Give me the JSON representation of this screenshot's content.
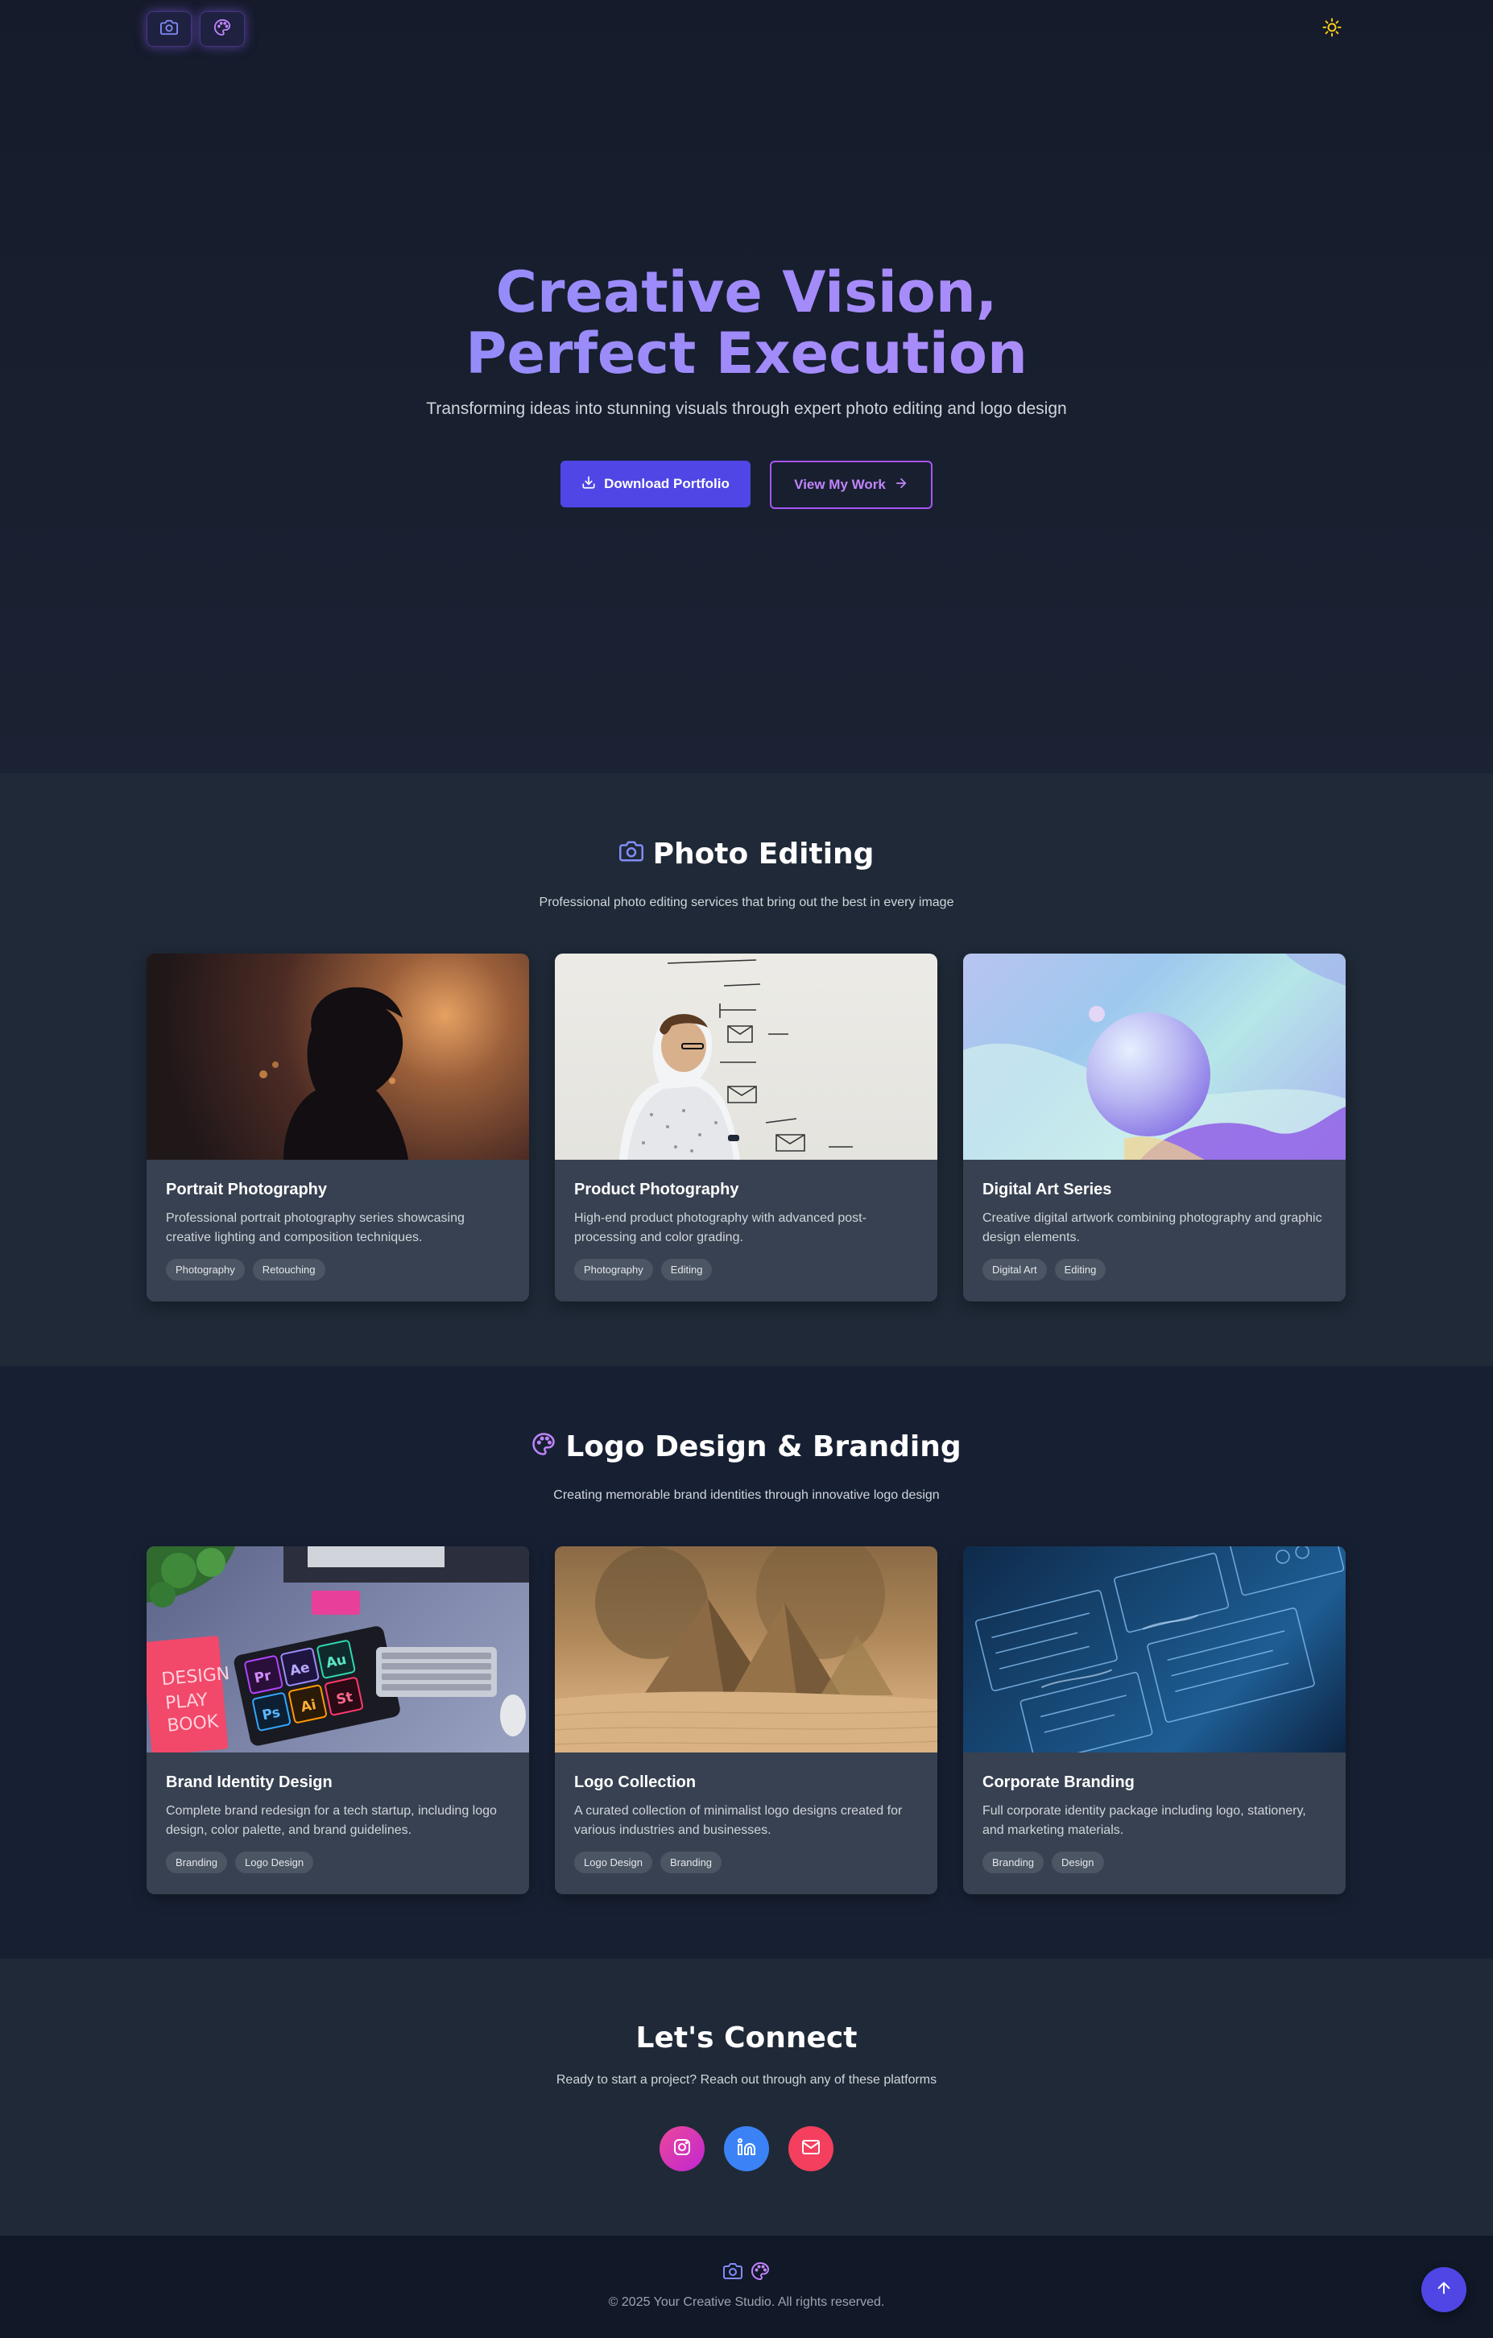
{
  "header": {
    "logo_icons": [
      "camera-icon",
      "palette-icon"
    ],
    "theme_toggle_icon": "sun-icon"
  },
  "hero": {
    "title_line1": "Creative Vision,",
    "title_line2": "Perfect Execution",
    "subtitle": "Transforming ideas into stunning visuals through expert photo editing and logo design",
    "primary_button": "Download Portfolio",
    "secondary_button": "View My Work"
  },
  "photo_section": {
    "title": "Photo Editing",
    "subtitle": "Professional photo editing services that bring out the best in every image",
    "cards": [
      {
        "title": "Portrait Photography",
        "description": "Professional portrait photography series showcasing creative lighting and composition techniques.",
        "tags": [
          "Photography",
          "Retouching"
        ]
      },
      {
        "title": "Product Photography",
        "description": "High-end product photography with advanced post-processing and color grading.",
        "tags": [
          "Photography",
          "Editing"
        ]
      },
      {
        "title": "Digital Art Series",
        "description": "Creative digital artwork combining photography and graphic design elements.",
        "tags": [
          "Digital Art",
          "Editing"
        ]
      }
    ]
  },
  "logo_section": {
    "title": "Logo Design & Branding",
    "subtitle": "Creating memorable brand identities through innovative logo design",
    "cards": [
      {
        "title": "Brand Identity Design",
        "description": "Complete brand redesign for a tech startup, including logo design, color palette, and brand guidelines.",
        "tags": [
          "Branding",
          "Logo Design"
        ]
      },
      {
        "title": "Logo Collection",
        "description": "A curated collection of minimalist logo designs created for various industries and businesses.",
        "tags": [
          "Logo Design",
          "Branding"
        ]
      },
      {
        "title": "Corporate Branding",
        "description": "Full corporate identity package including logo, stationery, and marketing materials.",
        "tags": [
          "Branding",
          "Design"
        ]
      }
    ]
  },
  "connect": {
    "title": "Let's Connect",
    "subtitle": "Ready to start a project? Reach out through any of these platforms",
    "socials": [
      {
        "name": "instagram-icon",
        "color": "#d946ef"
      },
      {
        "name": "linkedin-icon",
        "color": "#3b82f6"
      },
      {
        "name": "mail-icon",
        "color": "#f43f5e"
      }
    ]
  },
  "footer": {
    "copyright": "© 2025 Your Creative Studio. All rights reserved."
  },
  "colors": {
    "accent": "#4f46e5",
    "accent_purple": "#a855f7",
    "background": "#111827",
    "card": "#374151"
  }
}
